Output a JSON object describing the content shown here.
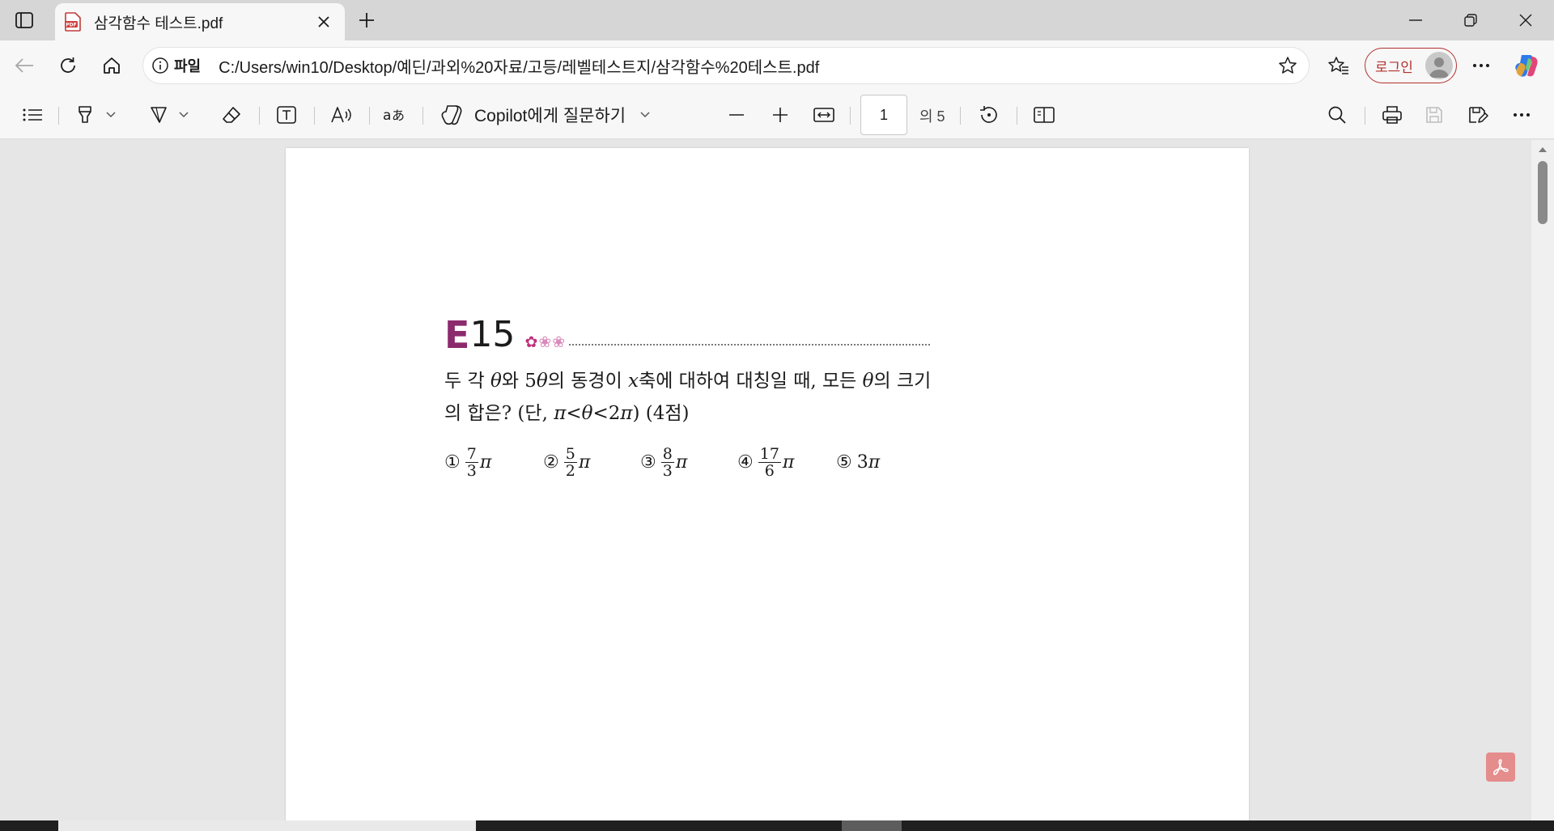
{
  "window": {
    "tab_title": "삼각함수 테스트.pdf",
    "tab_favicon": "pdf-file-icon"
  },
  "addressbar": {
    "scheme_label": "파일",
    "url": "C:/Users/win10/Desktop/예딘/과외%20자료/고등/레벨테스트지/삼각함수%20테스트.pdf",
    "login_label": "로그인"
  },
  "pdf_toolbar": {
    "copilot_label": "Copilot에게 질문하기",
    "page_current": "1",
    "page_total": "의 5"
  },
  "document": {
    "question_letter": "E",
    "question_number": "15",
    "question_line1_parts": [
      "두 각 ",
      "θ",
      "와 5",
      "θ",
      "의 동경이 ",
      "x",
      "축에 대하여 대칭일 때, 모든 ",
      "θ",
      "의 크기"
    ],
    "question_line2_parts": [
      "의 합은? (단, ",
      "π",
      "<",
      "θ",
      "<2",
      "π",
      ") (4점)"
    ],
    "choices": [
      {
        "mark": "①",
        "numerator": "7",
        "denominator": "3",
        "suffix": "π"
      },
      {
        "mark": "②",
        "numerator": "5",
        "denominator": "2",
        "suffix": "π"
      },
      {
        "mark": "③",
        "numerator": "8",
        "denominator": "3",
        "suffix": "π"
      },
      {
        "mark": "④",
        "numerator": "17",
        "denominator": "6",
        "suffix": "π"
      },
      {
        "mark": "⑤",
        "text": "3",
        "suffix": "π"
      }
    ]
  },
  "colors": {
    "accent_question_letter": "#8c2a6e",
    "login_border": "#b2312d",
    "adobe_button": "#e58c8c"
  }
}
